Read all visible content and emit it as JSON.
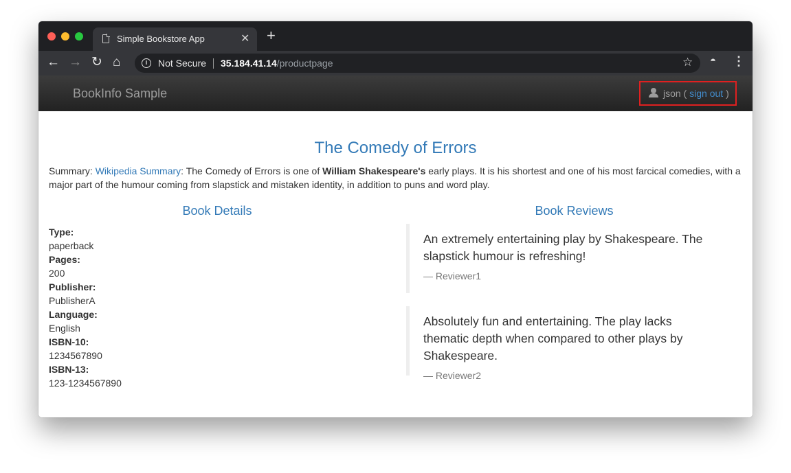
{
  "browser": {
    "tab_title": "Simple Bookstore App",
    "tab_close": "✕",
    "new_tab": "+",
    "security_label": "Not Secure",
    "url_host": "35.184.41.14",
    "url_path": "/productpage"
  },
  "navbar": {
    "brand": "BookInfo Sample",
    "user_name": "json",
    "open_paren": " ( ",
    "sign_out": "sign out",
    "close_paren": " )"
  },
  "book": {
    "title": "The Comedy of Errors",
    "summary_label": "Summary: ",
    "summary_link": "Wikipedia Summary",
    "summary_pre": ": The Comedy of Errors is one of ",
    "summary_bold": "William Shakespeare's",
    "summary_post": " early plays. It is his shortest and one of his most farcical comedies, with a major part of the humour coming from slapstick and mistaken identity, in addition to puns and word play."
  },
  "details": {
    "heading": "Book Details",
    "fields": [
      {
        "label": "Type:",
        "value": "paperback"
      },
      {
        "label": "Pages:",
        "value": "200"
      },
      {
        "label": "Publisher:",
        "value": "PublisherA"
      },
      {
        "label": "Language:",
        "value": "English"
      },
      {
        "label": "ISBN-10:",
        "value": "1234567890"
      },
      {
        "label": "ISBN-13:",
        "value": "123-1234567890"
      }
    ]
  },
  "reviews": {
    "heading": "Book Reviews",
    "items": [
      {
        "text": "An extremely entertaining play by Shakespeare. The slapstick humour is refreshing!",
        "author": "— Reviewer1"
      },
      {
        "text": "Absolutely fun and entertaining. The play lacks thematic depth when compared to other plays by Shakespeare.",
        "author": "— Reviewer2"
      }
    ]
  },
  "icons": {
    "back": "back-arrow-icon",
    "forward": "forward-arrow-icon",
    "reload": "reload-icon",
    "home": "home-icon",
    "info": "info-icon",
    "star": "star-icon",
    "incognito": "incognito-icon",
    "menu": "kebab-menu-icon",
    "user": "user-icon"
  }
}
